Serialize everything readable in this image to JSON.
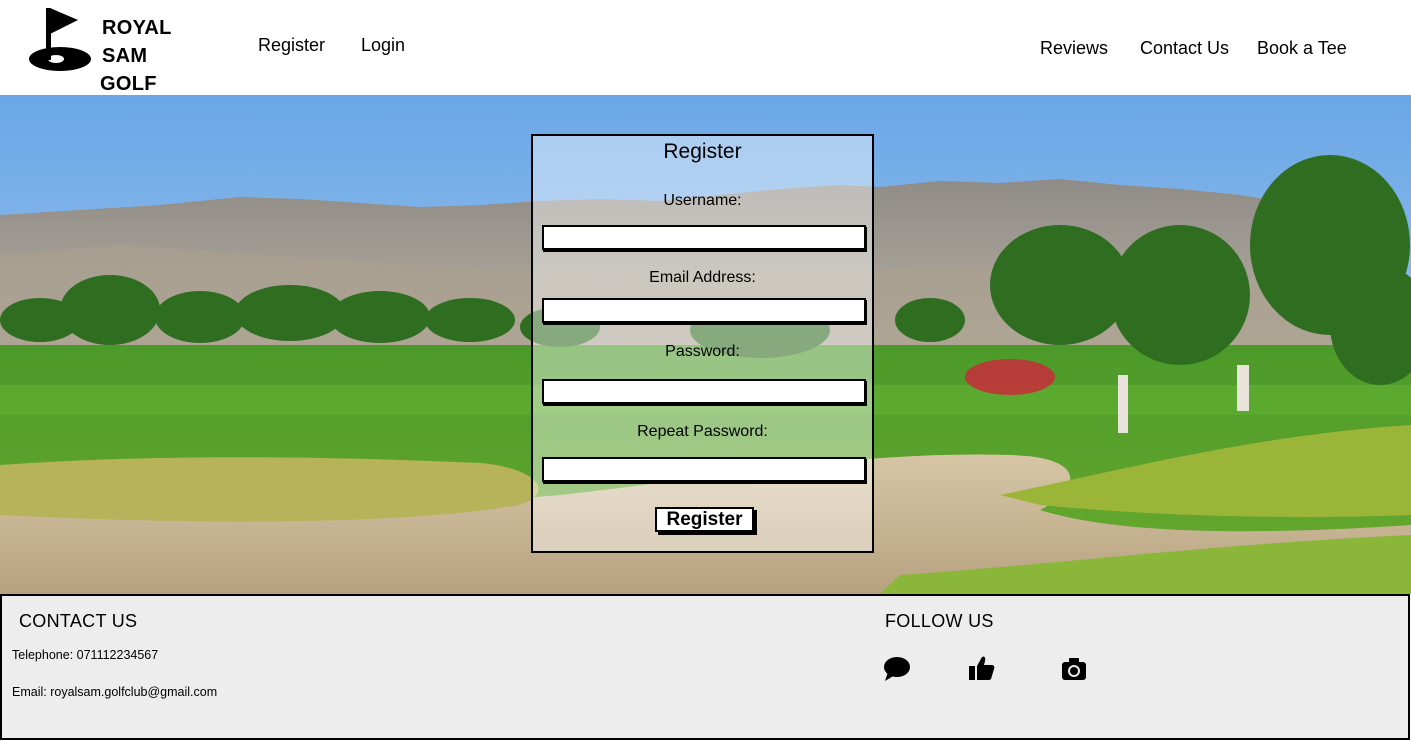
{
  "brand": {
    "line1": "ROYAL SAM",
    "line2": "GOLF CLUB",
    "icon": "golf-flag-icon"
  },
  "nav_left": [
    {
      "label": "Register"
    },
    {
      "label": "Login"
    }
  ],
  "nav_right": [
    {
      "label": "Reviews"
    },
    {
      "label": "Contact Us"
    },
    {
      "label": "Book a Tee"
    }
  ],
  "form": {
    "title": "Register",
    "fields": [
      {
        "label": "Username:",
        "value": "",
        "placeholder": ""
      },
      {
        "label": "Email Address:",
        "value": "",
        "placeholder": ""
      },
      {
        "label": "Password:",
        "value": "",
        "placeholder": ""
      },
      {
        "label": "Repeat Password:",
        "value": "",
        "placeholder": ""
      }
    ],
    "submit_label": "Register"
  },
  "footer": {
    "contact_heading": "CONTACT US",
    "telephone": "Telephone: 071112234567",
    "email": "Email: royalsam.golfclub@gmail.com",
    "follow_heading": "FOLLOW US",
    "social_icons": [
      "chat-bubble-icon",
      "thumbs-up-icon",
      "camera-icon"
    ]
  },
  "colors": {
    "footer_bg": "#ededed",
    "panel_bg": "rgba(255,255,255,0.42)"
  }
}
